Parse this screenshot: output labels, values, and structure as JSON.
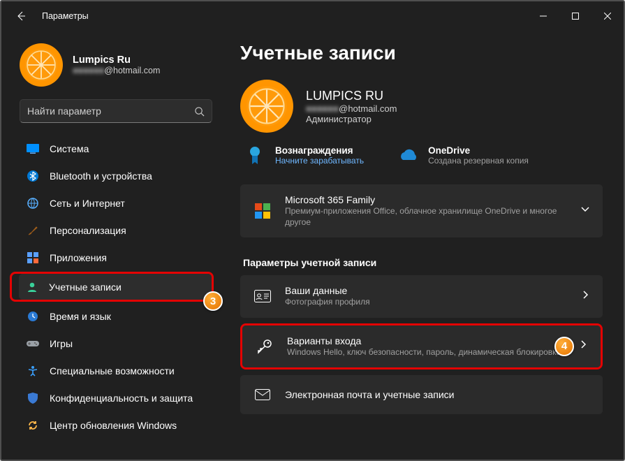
{
  "titlebar": {
    "title": "Параметры"
  },
  "search": {
    "placeholder": "Найти параметр"
  },
  "user": {
    "name": "Lumpics Ru",
    "email_masked": "■■■■■■",
    "email_domain": "@hotmail.com"
  },
  "nav": {
    "items": [
      {
        "id": "system",
        "label": "Система"
      },
      {
        "id": "bluetooth",
        "label": "Bluetooth и устройства"
      },
      {
        "id": "network",
        "label": "Сеть и Интернет"
      },
      {
        "id": "personalization",
        "label": "Персонализация"
      },
      {
        "id": "apps",
        "label": "Приложения"
      },
      {
        "id": "accounts",
        "label": "Учетные записи"
      },
      {
        "id": "time",
        "label": "Время и язык"
      },
      {
        "id": "gaming",
        "label": "Игры"
      },
      {
        "id": "accessibility",
        "label": "Специальные возможности"
      },
      {
        "id": "privacy",
        "label": "Конфиденциальность и защита"
      },
      {
        "id": "update",
        "label": "Центр обновления Windows"
      }
    ]
  },
  "main": {
    "title": "Учетные записи",
    "hero": {
      "name": "LUMPICS RU",
      "email_masked": "■■■■■■",
      "email_domain": "@hotmail.com",
      "role": "Администратор"
    },
    "promos": {
      "rewards": {
        "title": "Вознаграждения",
        "sub": "Начните зарабатывать"
      },
      "onedrive": {
        "title": "OneDrive",
        "sub": "Создана резервная копия"
      }
    },
    "cards": {
      "m365": {
        "title": "Microsoft 365 Family",
        "sub": "Премиум-приложения Office, облачное хранилище OneDrive и многое другое"
      },
      "yourinfo": {
        "title": "Ваши данные",
        "sub": "Фотография профиля"
      },
      "signin": {
        "title": "Варианты входа",
        "sub": "Windows Hello, ключ безопасности, пароль, динамическая блокировка"
      },
      "email": {
        "title": "Электронная почта и учетные записи"
      }
    },
    "section_label": "Параметры учетной записи"
  },
  "highlights": {
    "sidebar": "3",
    "signin": "4"
  }
}
